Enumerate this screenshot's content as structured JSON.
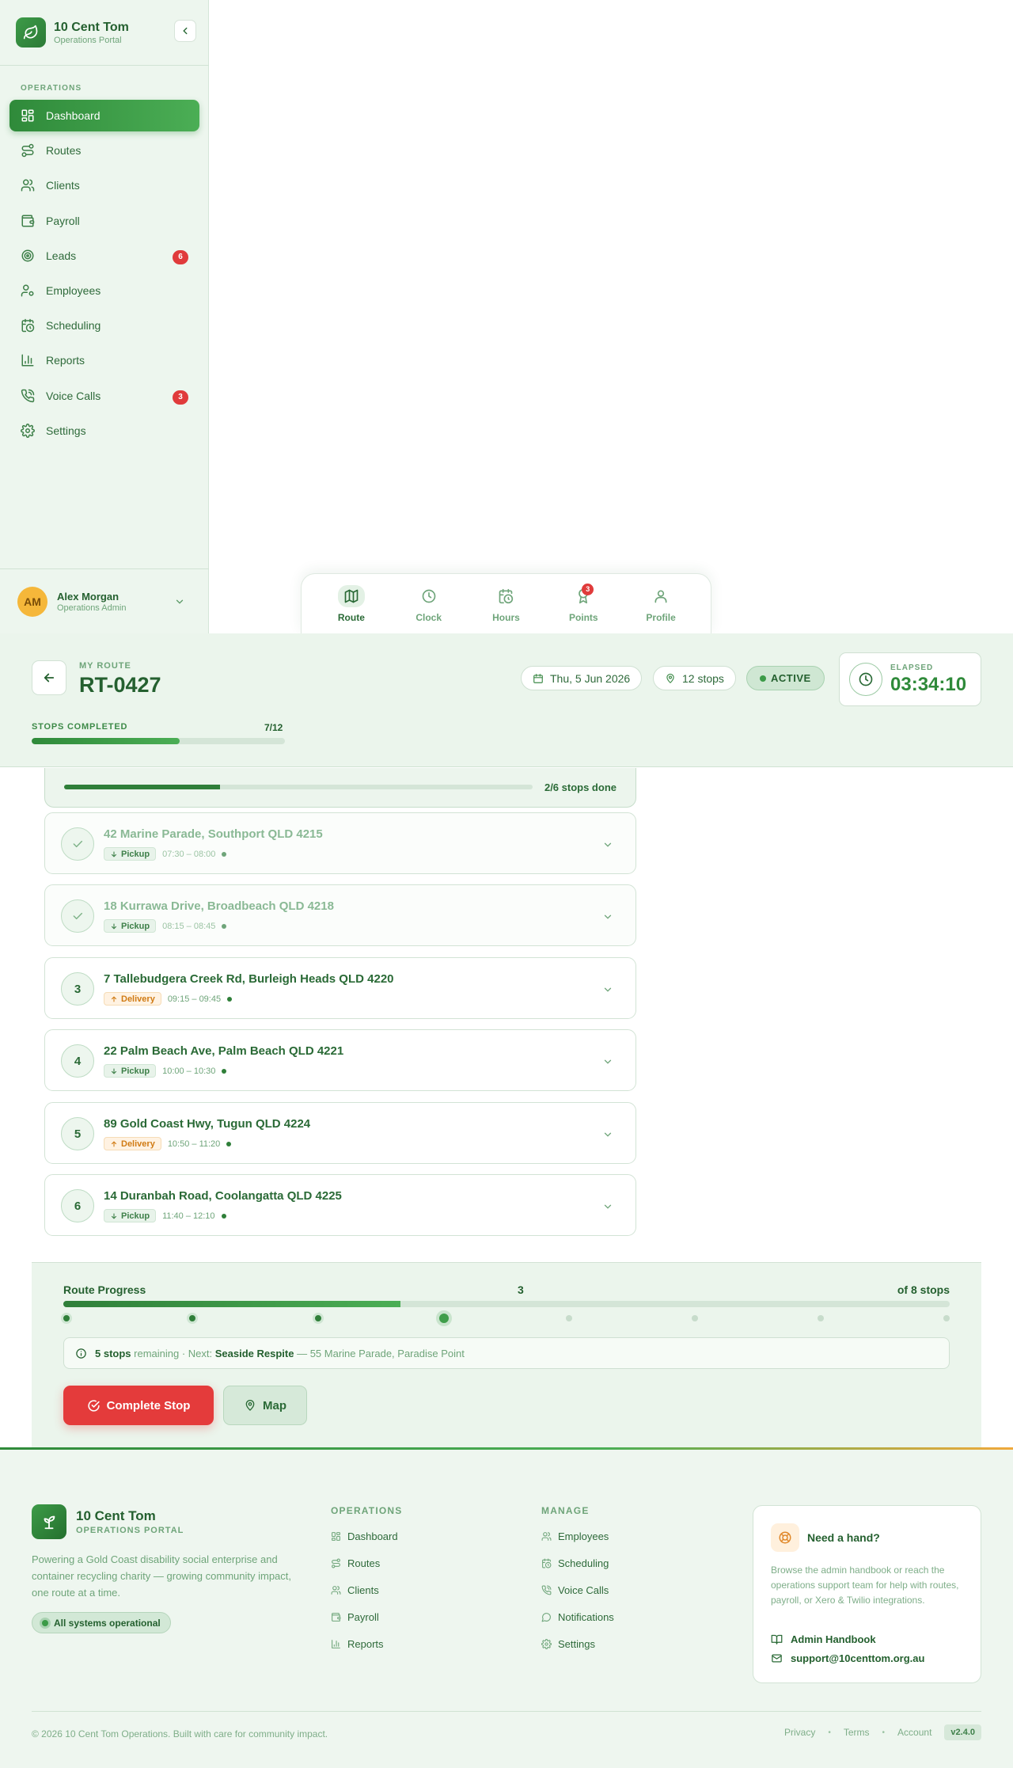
{
  "app": {
    "title": "10 Cent Tom",
    "subtitle": "Operations Portal"
  },
  "sidebar": {
    "section": "OPERATIONS",
    "items": [
      {
        "label": "Dashboard",
        "icon": "dashboard-icon",
        "active": true
      },
      {
        "label": "Routes",
        "icon": "routes-icon"
      },
      {
        "label": "Clients",
        "icon": "users-icon"
      },
      {
        "label": "Payroll",
        "icon": "wallet-icon"
      },
      {
        "label": "Leads",
        "icon": "target-icon",
        "badge": "6"
      },
      {
        "label": "Employees",
        "icon": "user-cog-icon"
      },
      {
        "label": "Scheduling",
        "icon": "calendar-clock-icon"
      },
      {
        "label": "Reports",
        "icon": "bar-chart-icon"
      },
      {
        "label": "Voice Calls",
        "icon": "phone-call-icon",
        "badge": "3"
      },
      {
        "label": "Settings",
        "icon": "gear-icon"
      }
    ],
    "user": {
      "initials": "AM",
      "name": "Alex Morgan",
      "role": "Operations Admin"
    }
  },
  "tabbar": {
    "tabs": [
      {
        "label": "Route",
        "icon": "map-icon",
        "active": true
      },
      {
        "label": "Clock",
        "icon": "clock-icon"
      },
      {
        "label": "Hours",
        "icon": "calendar-clock-icon"
      },
      {
        "label": "Points",
        "icon": "award-icon",
        "badge": "3"
      },
      {
        "label": "Profile",
        "icon": "user-icon"
      }
    ]
  },
  "route": {
    "label": "MY ROUTE",
    "id": "RT-0427",
    "date": "Thu, 5 Jun 2026",
    "stops": "12 stops",
    "status": "ACTIVE",
    "elapsed_label": "ELAPSED",
    "elapsed": "03:34:10",
    "stops_completed_label": "STOPS COMPLETED",
    "stops_completed": "7/12",
    "stops_completed_fraction": 0.583
  },
  "stop_list": {
    "progress_text": "2/6 stops done",
    "progress_fraction": 0.333,
    "stops": [
      {
        "number": "",
        "done": true,
        "address": "42 Marine Parade, Southport QLD 4215",
        "type": "Pickup",
        "time": "07:30 – 08:00"
      },
      {
        "number": "",
        "done": true,
        "address": "18 Kurrawa Drive, Broadbeach QLD 4218",
        "type": "Pickup",
        "time": "08:15 – 08:45"
      },
      {
        "number": "3",
        "done": false,
        "address": "7 Tallebudgera Creek Rd, Burleigh Heads QLD 4220",
        "type": "Delivery",
        "time": "09:15 – 09:45"
      },
      {
        "number": "4",
        "done": false,
        "address": "22 Palm Beach Ave, Palm Beach QLD 4221",
        "type": "Pickup",
        "time": "10:00 – 10:30"
      },
      {
        "number": "5",
        "done": false,
        "address": "89 Gold Coast Hwy, Tugun QLD 4224",
        "type": "Delivery",
        "time": "10:50 – 11:20"
      },
      {
        "number": "6",
        "done": false,
        "address": "14 Duranbah Road, Coolangatta QLD 4225",
        "type": "Pickup",
        "time": "11:40 – 12:10"
      }
    ]
  },
  "route_progress": {
    "title": "Route Progress",
    "current": "3",
    "of": "of 8 stops",
    "fraction": 0.38,
    "steps": [
      "done",
      "done",
      "done",
      "current",
      "todo",
      "todo",
      "todo",
      "todo"
    ],
    "remaining": "5 stops",
    "remaining_suffix": "remaining · Next:",
    "next_name": "Seaside Respite",
    "next_address": "— 55 Marine Parade, Paradise Point",
    "complete_label": "Complete Stop",
    "map_label": "Map"
  },
  "footer": {
    "title": "10 Cent Tom",
    "subtitle": "OPERATIONS PORTAL",
    "description": "Powering a Gold Coast disability social enterprise and container recycling charity — growing community impact, one route at a time.",
    "status": "All systems operational",
    "operations_title": "OPERATIONS",
    "operations_links": [
      "Dashboard",
      "Routes",
      "Clients",
      "Payroll",
      "Reports"
    ],
    "manage_title": "MANAGE",
    "manage_links": [
      "Employees",
      "Scheduling",
      "Voice Calls",
      "Notifications",
      "Settings"
    ],
    "help_title": "Need a hand?",
    "help_desc": "Browse the admin handbook or reach the operations support team for help with routes, payroll, or Xero & Twilio integrations.",
    "help_handbook": "Admin Handbook",
    "help_email": "support@10centtom.org.au",
    "copyright": "© 2026 10 Cent Tom Operations. Built with care for community impact.",
    "privacy": "Privacy",
    "terms": "Terms",
    "account": "Account",
    "version": "v2.4.0"
  },
  "colors": {
    "brand": "#2f8a3a",
    "accent": "#e43b3b",
    "warning": "#d07b14",
    "avatar": "#f5b73a"
  }
}
